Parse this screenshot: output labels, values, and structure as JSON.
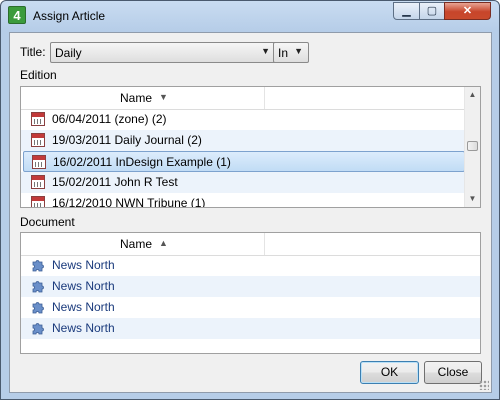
{
  "window": {
    "title": "Assign Article",
    "icon_glyph": "4",
    "controls": {
      "minimize": "▁",
      "maximize": "▢",
      "close": "✕"
    }
  },
  "title_field": {
    "label": "Title:",
    "value": "Daily",
    "operator": "In"
  },
  "edition": {
    "label": "Edition",
    "column_header": "Name",
    "sort": "descending",
    "rows": [
      {
        "name": "06/04/2011 (zone) (2)",
        "selected": false
      },
      {
        "name": "19/03/2011 Daily Journal (2)",
        "selected": false
      },
      {
        "name": "16/02/2011 InDesign Example (1)",
        "selected": true
      },
      {
        "name": "15/02/2011 John R Test",
        "selected": false
      },
      {
        "name": "16/12/2010 NWN Tribune (1)",
        "selected": false
      }
    ]
  },
  "document": {
    "label": "Document",
    "column_header": "Name",
    "sort": "ascending",
    "rows": [
      {
        "name": "News North"
      },
      {
        "name": "News North"
      },
      {
        "name": "News North"
      },
      {
        "name": "News North"
      }
    ]
  },
  "buttons": {
    "ok": "OK",
    "close": "Close"
  },
  "colors": {
    "selection": "#c1dcf5",
    "alt_row": "#ecf3fb",
    "link_text": "#1a3a7c"
  }
}
